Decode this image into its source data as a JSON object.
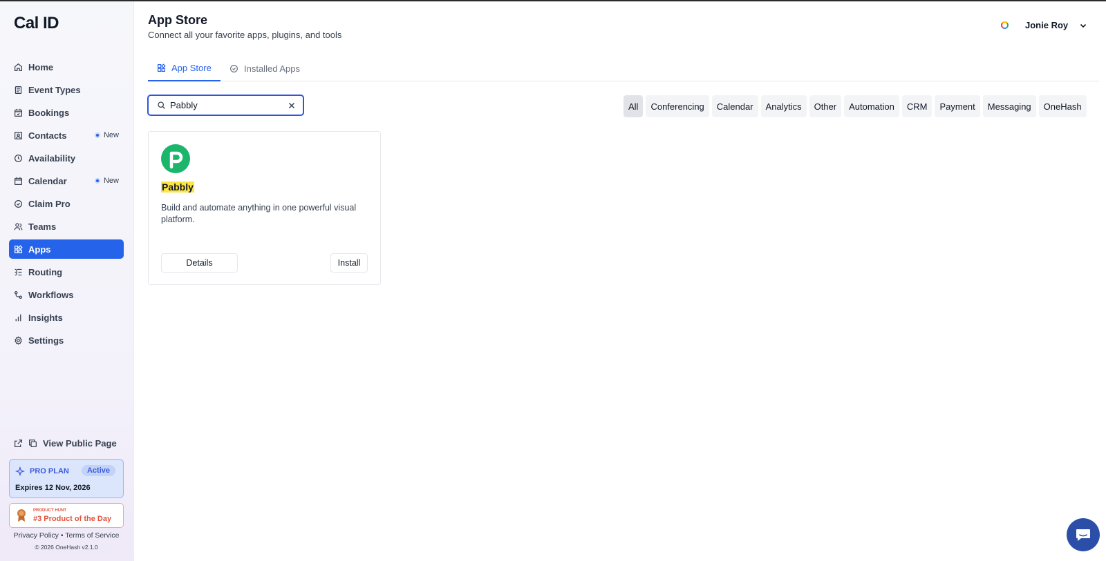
{
  "sidebar": {
    "logo": "Cal ID",
    "items": [
      {
        "label": "Home",
        "icon": "home-icon"
      },
      {
        "label": "Event Types",
        "icon": "event-types-icon"
      },
      {
        "label": "Bookings",
        "icon": "calendar-check-icon"
      },
      {
        "label": "Contacts",
        "icon": "contacts-icon",
        "badge": "New"
      },
      {
        "label": "Availability",
        "icon": "clock-icon"
      },
      {
        "label": "Calendar",
        "icon": "calendar-icon",
        "badge": "New"
      },
      {
        "label": "Claim Pro",
        "icon": "badge-check-icon"
      },
      {
        "label": "Teams",
        "icon": "users-icon"
      },
      {
        "label": "Apps",
        "icon": "apps-icon",
        "active": true
      },
      {
        "label": "Routing",
        "icon": "routing-icon"
      },
      {
        "label": "Workflows",
        "icon": "workflow-icon"
      },
      {
        "label": "Insights",
        "icon": "bar-chart-icon"
      },
      {
        "label": "Settings",
        "icon": "gear-icon"
      }
    ],
    "view_public_page": "View Public Page",
    "plan": {
      "label": "PRO PLAN",
      "status": "Active",
      "expires": "Expires 12 Nov, 2026"
    },
    "product_hunt": {
      "small": "PRODUCT HUNT",
      "title": "#3 Product of the Day"
    },
    "footer": {
      "privacy": "Privacy Policy",
      "separator": "•",
      "terms": "Terms of Service",
      "copyright": "© 2026 OneHash v2.1.0"
    }
  },
  "header": {
    "title": "App Store",
    "subtitle": "Connect all your favorite apps, plugins, and tools",
    "user_name": "Jonie Roy"
  },
  "tabs": [
    {
      "label": "App Store",
      "icon": "apps-icon",
      "active": true
    },
    {
      "label": "Installed Apps",
      "icon": "check-circle-icon",
      "active": false
    }
  ],
  "search": {
    "value": "Pabbly",
    "placeholder": "Search"
  },
  "categories": [
    "All",
    "Conferencing",
    "Calendar",
    "Analytics",
    "Other",
    "Automation",
    "CRM",
    "Payment",
    "Messaging",
    "OneHash"
  ],
  "selected_category": "All",
  "apps": [
    {
      "name": "Pabbly",
      "description": "Build and automate anything in one powerful visual platform.",
      "details_label": "Details",
      "install_label": "Install",
      "brand_color": "#1bb56b"
    }
  ],
  "colors": {
    "accent": "#2563eb",
    "highlight": "#fce545",
    "chat": "#2b4fa8"
  }
}
